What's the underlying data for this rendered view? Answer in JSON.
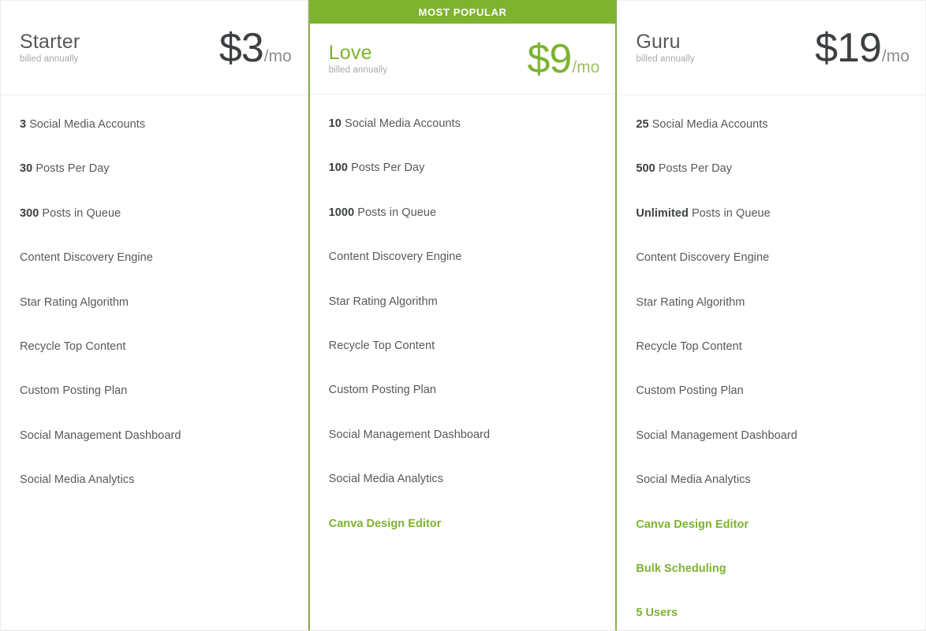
{
  "brand": {
    "green": "#7db32f",
    "green_border": "#8aad4b",
    "text_dark": "#3c4043",
    "text_muted": "#a7a9ab"
  },
  "plans": [
    {
      "name": "Starter",
      "billing": "billed annually",
      "price_amount": "$3",
      "price_period": "/mo",
      "featured": false,
      "badge": "",
      "features": [
        {
          "qty": "3",
          "label": " Social Media Accounts",
          "highlight": false
        },
        {
          "qty": "30",
          "label": " Posts Per Day",
          "highlight": false
        },
        {
          "qty": "300",
          "label": " Posts in Queue",
          "highlight": false
        },
        {
          "qty": "",
          "label": "Content Discovery Engine",
          "highlight": false
        },
        {
          "qty": "",
          "label": "Star Rating Algorithm",
          "highlight": false
        },
        {
          "qty": "",
          "label": "Recycle Top Content",
          "highlight": false
        },
        {
          "qty": "",
          "label": "Custom Posting Plan",
          "highlight": false
        },
        {
          "qty": "",
          "label": "Social Management Dashboard",
          "highlight": false
        },
        {
          "qty": "",
          "label": "Social Media Analytics",
          "highlight": false
        }
      ]
    },
    {
      "name": "Love",
      "billing": "billed annually",
      "price_amount": "$9",
      "price_period": "/mo",
      "featured": true,
      "badge": "MOST POPULAR",
      "features": [
        {
          "qty": "10",
          "label": " Social Media Accounts",
          "highlight": false
        },
        {
          "qty": "100",
          "label": " Posts Per Day",
          "highlight": false
        },
        {
          "qty": "1000",
          "label": " Posts in Queue",
          "highlight": false
        },
        {
          "qty": "",
          "label": "Content Discovery Engine",
          "highlight": false
        },
        {
          "qty": "",
          "label": "Star Rating Algorithm",
          "highlight": false
        },
        {
          "qty": "",
          "label": "Recycle Top Content",
          "highlight": false
        },
        {
          "qty": "",
          "label": "Custom Posting Plan",
          "highlight": false
        },
        {
          "qty": "",
          "label": "Social Management Dashboard",
          "highlight": false
        },
        {
          "qty": "",
          "label": "Social Media Analytics",
          "highlight": false
        },
        {
          "qty": "",
          "label": "Canva Design Editor",
          "highlight": true
        }
      ]
    },
    {
      "name": "Guru",
      "billing": "billed annually",
      "price_amount": "$19",
      "price_period": "/mo",
      "featured": false,
      "badge": "",
      "features": [
        {
          "qty": "25",
          "label": " Social Media Accounts",
          "highlight": false
        },
        {
          "qty": "500",
          "label": " Posts Per Day",
          "highlight": false
        },
        {
          "qty": "Unlimited",
          "label": " Posts in Queue",
          "highlight": false
        },
        {
          "qty": "",
          "label": "Content Discovery Engine",
          "highlight": false
        },
        {
          "qty": "",
          "label": "Star Rating Algorithm",
          "highlight": false
        },
        {
          "qty": "",
          "label": "Recycle Top Content",
          "highlight": false
        },
        {
          "qty": "",
          "label": "Custom Posting Plan",
          "highlight": false
        },
        {
          "qty": "",
          "label": "Social Management Dashboard",
          "highlight": false
        },
        {
          "qty": "",
          "label": "Social Media Analytics",
          "highlight": false
        },
        {
          "qty": "",
          "label": "Canva Design Editor",
          "highlight": true
        },
        {
          "qty": "",
          "label": "Bulk Scheduling",
          "highlight": true
        },
        {
          "qty": "",
          "label": "5 Users",
          "highlight": true
        }
      ]
    }
  ]
}
